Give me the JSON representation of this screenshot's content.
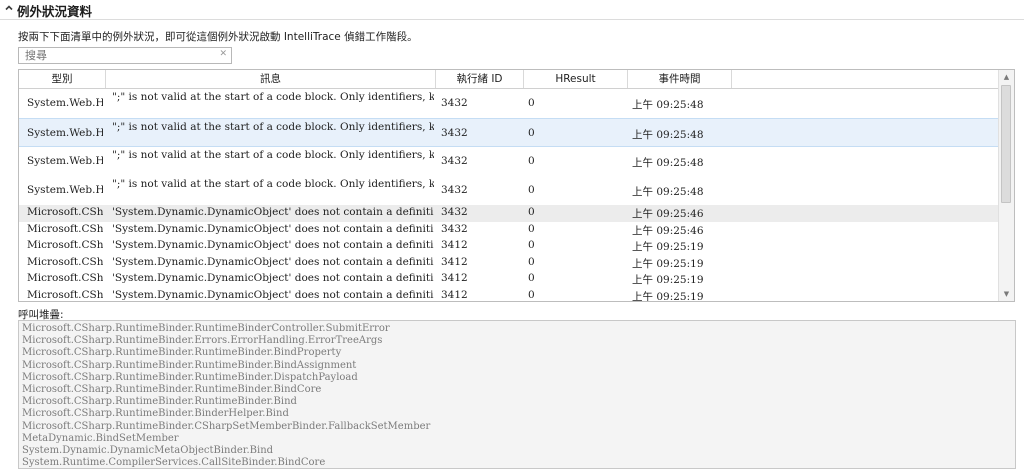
{
  "header": {
    "title": "例外狀況資料",
    "collapse_icon": "chevron-up-icon"
  },
  "description": "按兩下下面清單中的例外狀況，即可從這個例外狀況啟動 IntelliTrace 偵錯工作階段。",
  "search": {
    "placeholder": "搜尋",
    "value": "",
    "clear_icon": "close-icon"
  },
  "grid": {
    "columns": [
      {
        "key": "type",
        "label": "型別"
      },
      {
        "key": "message",
        "label": "訊息"
      },
      {
        "key": "thread",
        "label": "執行緒 ID"
      },
      {
        "key": "hresult",
        "label": "HResult"
      },
      {
        "key": "time",
        "label": "事件時間"
      }
    ],
    "rows": [
      {
        "type": "System.Web.HttpP",
        "message": "\";\" is not valid at the start of a code block.  Only identifiers, keywords, commen",
        "thread": "3432",
        "hresult": "0",
        "time": "上午 09:25:48",
        "state": "normal"
      },
      {
        "type": "System.Web.HttpP",
        "message": "\";\" is not valid at the start of a code block.  Only identifiers, keywords, commen",
        "thread": "3432",
        "hresult": "0",
        "time": "上午 09:25:48",
        "state": "selected"
      },
      {
        "type": "System.Web.HttpP",
        "message": "\";\" is not valid at the start of a code block.  Only identifiers, keywords, commen",
        "thread": "3432",
        "hresult": "0",
        "time": "上午 09:25:48",
        "state": "normal"
      },
      {
        "type": "System.Web.HttpP",
        "message": "\";\" is not valid at the start of a code block.  Only identifiers, keywords, commen",
        "thread": "3432",
        "hresult": "0",
        "time": "上午 09:25:48",
        "state": "normal"
      },
      {
        "type": "Microsoft.CSharp.",
        "message": "'System.Dynamic.DynamicObject' does not contain a definition for 'Message'",
        "thread": "3432",
        "hresult": "0",
        "time": "上午 09:25:46",
        "state": "hover"
      },
      {
        "type": "Microsoft.CSharp.",
        "message": "'System.Dynamic.DynamicObject' does not contain a definition for 'Message'",
        "thread": "3432",
        "hresult": "0",
        "time": "上午 09:25:46",
        "state": "normal"
      },
      {
        "type": "Microsoft.CSharp.",
        "message": "'System.Dynamic.DynamicObject' does not contain a definition for 'Message'",
        "thread": "3412",
        "hresult": "0",
        "time": "上午 09:25:19",
        "state": "normal"
      },
      {
        "type": "Microsoft.CSharp.",
        "message": "'System.Dynamic.DynamicObject' does not contain a definition for 'Message'",
        "thread": "3412",
        "hresult": "0",
        "time": "上午 09:25:19",
        "state": "normal"
      },
      {
        "type": "Microsoft.CSharp.",
        "message": "'System.Dynamic.DynamicObject' does not contain a definition for 'Title'",
        "thread": "3412",
        "hresult": "0",
        "time": "上午 09:25:19",
        "state": "normal"
      },
      {
        "type": "Microsoft.CSharp.",
        "message": "'System.Dynamic.DynamicObject' does not contain a definition for 'Title'",
        "thread": "3412",
        "hresult": "0",
        "time": "上午 09:25:19",
        "state": "normal"
      }
    ]
  },
  "call_stack": {
    "label": "呼叫堆疊:",
    "frames": [
      "Microsoft.CSharp.RuntimeBinder.RuntimeBinderController.SubmitError",
      "Microsoft.CSharp.RuntimeBinder.Errors.ErrorHandling.ErrorTreeArgs",
      "Microsoft.CSharp.RuntimeBinder.RuntimeBinder.BindProperty",
      "Microsoft.CSharp.RuntimeBinder.RuntimeBinder.BindAssignment",
      "Microsoft.CSharp.RuntimeBinder.RuntimeBinder.DispatchPayload",
      "Microsoft.CSharp.RuntimeBinder.RuntimeBinder.BindCore",
      "Microsoft.CSharp.RuntimeBinder.RuntimeBinder.Bind",
      "Microsoft.CSharp.RuntimeBinder.BinderHelper.Bind",
      "Microsoft.CSharp.RuntimeBinder.CSharpSetMemberBinder.FallbackSetMember",
      "MetaDynamic.BindSetMember",
      "System.Dynamic.DynamicMetaObjectBinder.Bind",
      "System.Runtime.CompilerServices.CallSiteBinder.BindCore"
    ]
  },
  "colors": {
    "selected_row": "#e8f1fb",
    "hover_row": "#ececec",
    "stack_bg": "#f4f4f4",
    "stack_text": "#7b7b7b"
  }
}
